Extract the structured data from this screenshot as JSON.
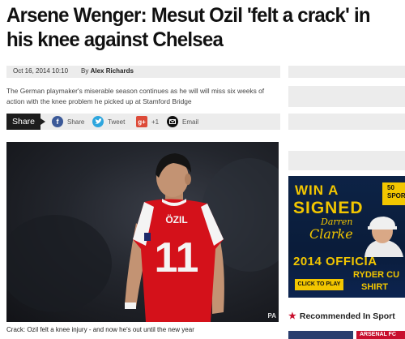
{
  "article": {
    "headline": "Arsene Wenger: Mesut Ozil 'felt a crack' in his knee against Chelsea",
    "date": "Oct 16, 2014 10:10",
    "byline_prefix": "By",
    "author": "Alex Richards",
    "summary": "The German playmaker's miserable season continues as he will will miss six weeks of action with the knee problem he picked up at Stamford Bridge",
    "photo_credit": "PA",
    "caption": "Crack: Ozil felt a knee injury - and now he's out until the new year",
    "jersey_name": "ÖZIL",
    "jersey_number": "11"
  },
  "share": {
    "label": "Share",
    "facebook": "Share",
    "twitter": "Tweet",
    "gplus": "+1",
    "email": "Email"
  },
  "ad": {
    "line1": "WIN A",
    "line2": "SIGNED",
    "sig1": "Darren",
    "sig2": "Clarke",
    "line3": "2014 OFFICIA",
    "line4": "RYDER CU",
    "line5": "SHIRT",
    "cta": "CLICK TO PLAY",
    "badge_num": "50",
    "badge_text": "SPOR"
  },
  "sidebar": {
    "recommended": "Recommended In Sport",
    "thumb_label": "ARSENAL FC"
  },
  "colors": {
    "facebook": "#3b5998",
    "twitter": "#2ea6de",
    "gplus": "#dd4b39",
    "email": "#111111",
    "arsenal_red": "#d4111a",
    "ad_gold": "#f2c600"
  }
}
